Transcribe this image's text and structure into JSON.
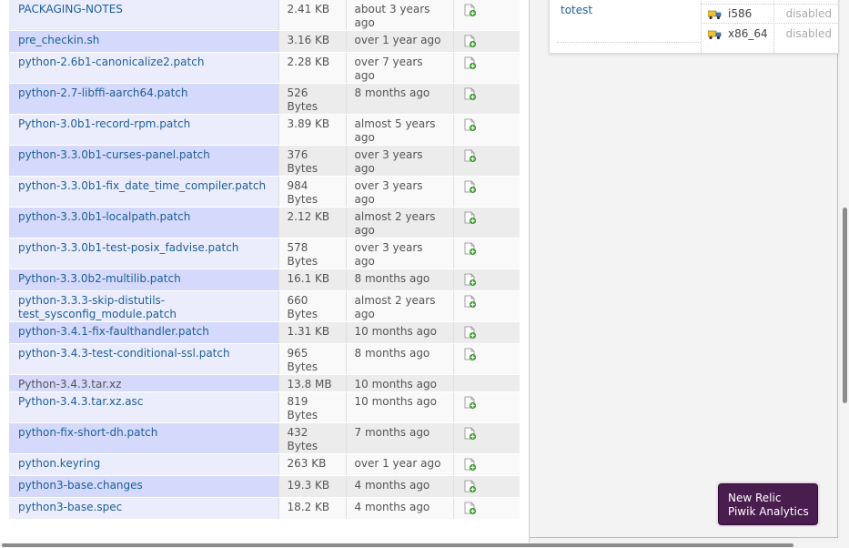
{
  "files": [
    {
      "name": "PACKAGING-NOTES",
      "size": "2.41 KB",
      "date": "about 3 years ago",
      "link": true,
      "action": true
    },
    {
      "name": "pre_checkin.sh",
      "size": "3.16 KB",
      "date": "over 1 year ago",
      "link": true,
      "action": true
    },
    {
      "name": "python-2.6b1-canonicalize2.patch",
      "size": "2.28 KB",
      "date": "over 7 years ago",
      "link": true,
      "action": true
    },
    {
      "name": "python-2.7-libffi-aarch64.patch",
      "size": "526 Bytes",
      "date": "8 months ago",
      "link": true,
      "action": true
    },
    {
      "name": "Python-3.0b1-record-rpm.patch",
      "size": "3.89 KB",
      "date": "almost 5 years ago",
      "link": true,
      "action": true
    },
    {
      "name": "python-3.3.0b1-curses-panel.patch",
      "size": "376 Bytes",
      "date": "over 3 years ago",
      "link": true,
      "action": true
    },
    {
      "name": "python-3.3.0b1-fix_date_time_compiler.patch",
      "size": "984 Bytes",
      "date": "over 3 years ago",
      "link": true,
      "action": true
    },
    {
      "name": "python-3.3.0b1-localpath.patch",
      "size": "2.12 KB",
      "date": "almost 2 years ago",
      "link": true,
      "action": true
    },
    {
      "name": "python-3.3.0b1-test-posix_fadvise.patch",
      "size": "578 Bytes",
      "date": "over 3 years ago",
      "link": true,
      "action": true
    },
    {
      "name": "Python-3.3.0b2-multilib.patch",
      "size": "16.1 KB",
      "date": "8 months ago",
      "link": true,
      "action": true
    },
    {
      "name": "python-3.3.3-skip-distutils-test_sysconfig_module.patch",
      "size": "660 Bytes",
      "date": "almost 2 years ago",
      "link": true,
      "action": true
    },
    {
      "name": "python-3.4.1-fix-faulthandler.patch",
      "size": "1.31 KB",
      "date": "10 months ago",
      "link": true,
      "action": true
    },
    {
      "name": "python-3.4.3-test-conditional-ssl.patch",
      "size": "965 Bytes",
      "date": "8 months ago",
      "link": true,
      "action": true
    },
    {
      "name": "Python-3.4.3.tar.xz",
      "size": "13.8 MB",
      "date": "10 months ago",
      "link": false,
      "action": false
    },
    {
      "name": "Python-3.4.3.tar.xz.asc",
      "size": "819 Bytes",
      "date": "10 months ago",
      "link": true,
      "action": true
    },
    {
      "name": "python-fix-short-dh.patch",
      "size": "432 Bytes",
      "date": "7 months ago",
      "link": true,
      "action": true
    },
    {
      "name": "python.keyring",
      "size": "263 KB",
      "date": "over 1 year ago",
      "link": true,
      "action": true
    },
    {
      "name": "python3-base.changes",
      "size": "19.3 KB",
      "date": "4 months ago",
      "link": true,
      "action": true
    },
    {
      "name": "python3-base.spec",
      "size": "18.2 KB",
      "date": "4 months ago",
      "link": true,
      "action": true
    }
  ],
  "repository": {
    "name": "totest",
    "archs": [
      {
        "name": "i586",
        "status": "disabled"
      },
      {
        "name": "x86_64",
        "status": "disabled"
      }
    ]
  },
  "badge": {
    "line1": "New Relic",
    "line2": "Piwik Analytics"
  },
  "icons": {
    "add": "add-file-icon",
    "arch": "truck-icon"
  },
  "colors": {
    "link": "#1d5f99",
    "badge_bg": "#4a1d4f",
    "name_odd": "#d5d9fb",
    "name_even": "#ebedfd"
  }
}
